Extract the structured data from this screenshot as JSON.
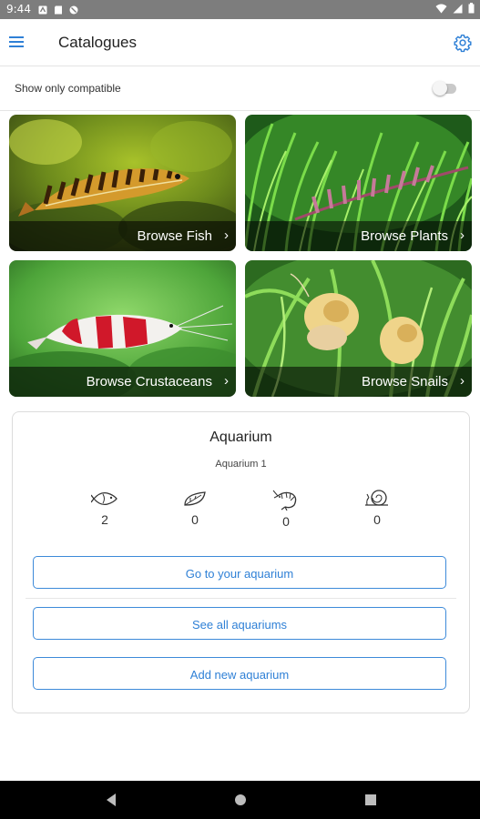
{
  "status_bar": {
    "time": "9:44"
  },
  "app_bar": {
    "title": "Catalogues",
    "menu_icon": "hamburger-menu-icon",
    "settings_icon": "gear-icon",
    "accent": "#2f80d6"
  },
  "filter": {
    "label": "Show only compatible",
    "enabled": false
  },
  "tiles": [
    {
      "label": "Browse Fish"
    },
    {
      "label": "Browse Plants"
    },
    {
      "label": "Browse Crustaceans"
    },
    {
      "label": "Browse Snails"
    }
  ],
  "aquarium_card": {
    "title": "Aquarium",
    "name": "Aquarium 1",
    "counts": [
      {
        "icon": "fish-icon",
        "value": "2"
      },
      {
        "icon": "leaf-icon",
        "value": "0"
      },
      {
        "icon": "shrimp-icon",
        "value": "0"
      },
      {
        "icon": "snail-icon",
        "value": "0"
      }
    ],
    "buttons": {
      "go": "Go to your aquarium",
      "see_all": "See all aquariums",
      "add_new": "Add new aquarium"
    }
  }
}
